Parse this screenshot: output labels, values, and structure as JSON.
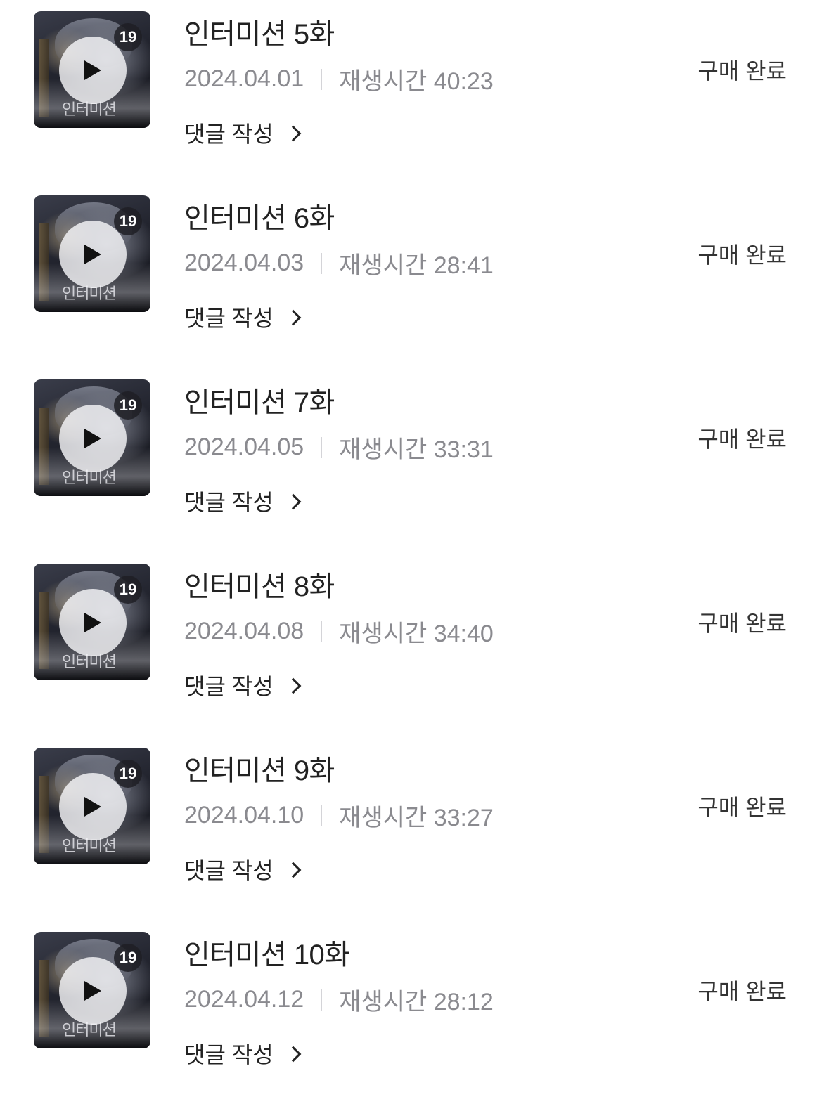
{
  "episodes": [
    {
      "title": "인터미션 5화",
      "date": "2024.04.01",
      "runtime": "재생시간 40:23",
      "comment_label": "댓글 작성",
      "status": "구매 완료",
      "age_rating": "19",
      "cover_title": "인터미션"
    },
    {
      "title": "인터미션 6화",
      "date": "2024.04.03",
      "runtime": "재생시간 28:41",
      "comment_label": "댓글 작성",
      "status": "구매 완료",
      "age_rating": "19",
      "cover_title": "인터미션"
    },
    {
      "title": "인터미션 7화",
      "date": "2024.04.05",
      "runtime": "재생시간 33:31",
      "comment_label": "댓글 작성",
      "status": "구매 완료",
      "age_rating": "19",
      "cover_title": "인터미션"
    },
    {
      "title": "인터미션 8화",
      "date": "2024.04.08",
      "runtime": "재생시간 34:40",
      "comment_label": "댓글 작성",
      "status": "구매 완료",
      "age_rating": "19",
      "cover_title": "인터미션"
    },
    {
      "title": "인터미션 9화",
      "date": "2024.04.10",
      "runtime": "재생시간 33:27",
      "comment_label": "댓글 작성",
      "status": "구매 완료",
      "age_rating": "19",
      "cover_title": "인터미션"
    },
    {
      "title": "인터미션 10화",
      "date": "2024.04.12",
      "runtime": "재생시간 28:12",
      "comment_label": "댓글 작성",
      "status": "구매 완료",
      "age_rating": "19",
      "cover_title": "인터미션"
    }
  ],
  "icons": {
    "play": "play-icon",
    "chevron": "chevron-right-icon"
  },
  "colors": {
    "title": "#222222",
    "meta": "#8a8a8f",
    "separator": "#d4d4d8",
    "status": "#333333",
    "badge_bg": "#1e1e24"
  }
}
